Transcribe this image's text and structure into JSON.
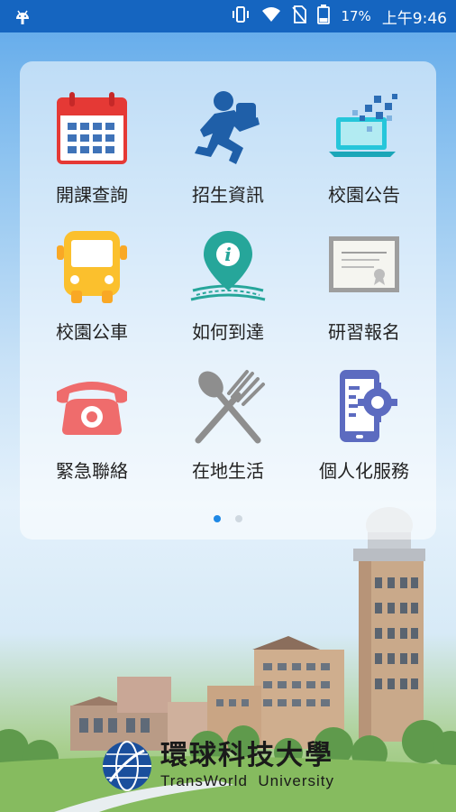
{
  "status_bar": {
    "battery": "17%",
    "time": "上午9:46",
    "icons": [
      "android-icon",
      "vibrate-icon",
      "wifi-icon",
      "no-sim-icon",
      "battery-icon"
    ]
  },
  "menu": {
    "items": [
      {
        "label": "開課查詢",
        "icon": "calendar-icon"
      },
      {
        "label": "招生資訊",
        "icon": "running-man-icon"
      },
      {
        "label": "校園公告",
        "icon": "laptop-icon"
      },
      {
        "label": "校園公車",
        "icon": "bus-icon"
      },
      {
        "label": "如何到達",
        "icon": "map-pin-icon"
      },
      {
        "label": "研習報名",
        "icon": "certificate-icon"
      },
      {
        "label": "緊急聯絡",
        "icon": "telephone-icon"
      },
      {
        "label": "在地生活",
        "icon": "spoon-fork-icon"
      },
      {
        "label": "個人化服務",
        "icon": "phone-settings-icon"
      }
    ],
    "page_indicator": {
      "current": 1,
      "total": 2
    }
  },
  "brand": {
    "name_zh": "環球科技大學",
    "name_en": "TransWorld  University"
  },
  "colors": {
    "status_bar": "#1565c0",
    "page_dot_active": "#1e88e5"
  }
}
